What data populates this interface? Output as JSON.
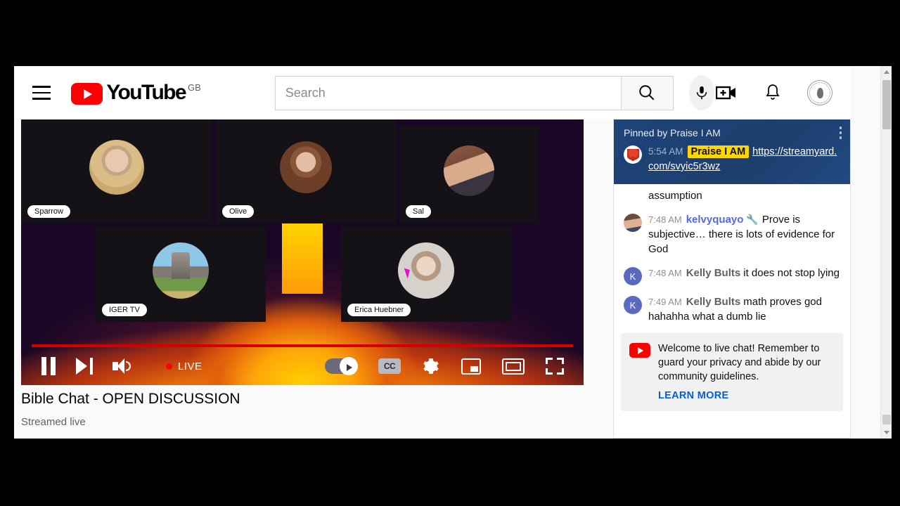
{
  "masthead": {
    "menu_label": "Guide",
    "logo_text": "YouTube",
    "country_code": "GB",
    "search_placeholder": "Search",
    "search_value": "",
    "search_button_label": "Search",
    "mic_label": "Search with your voice",
    "create_label": "Create",
    "notifications_label": "Notifications",
    "avatar_label": "Account"
  },
  "player": {
    "state": "playing",
    "live_label": "LIVE",
    "progress_percent": 100,
    "pause_label": "Pause",
    "next_label": "Next",
    "volume_label": "Mute",
    "autoplay_label": "Autoplay is on",
    "captions_label": "CC",
    "settings_label": "Settings",
    "miniplayer_label": "Miniplayer",
    "theater_label": "Theater mode",
    "fullscreen_label": "Full screen",
    "participants": [
      {
        "name": "Sparrow",
        "avatar": "blonde"
      },
      {
        "name": "Olive",
        "avatar": "brunette"
      },
      {
        "name": "Sal",
        "avatar": "man"
      },
      {
        "name": "IGER TV",
        "avatar": "scene"
      },
      {
        "name": "Erica Huebner",
        "avatar": "girl"
      }
    ]
  },
  "video": {
    "title": "Bible Chat - OPEN DISCUSSION",
    "subtitle": "Streamed live"
  },
  "chat": {
    "pinned": {
      "banner_label": "Pinned by Praise I AM",
      "time": "5:54 AM",
      "author": "Praise I AM",
      "link_text": "https://streamyard.com/svyic5r3wz",
      "menu_label": "More options",
      "background_color": "#1d3e6e",
      "author_highlight_color": "#ffd600"
    },
    "truncated_top_message": "assumption",
    "messages": [
      {
        "time": "7:48 AM",
        "author": "kelvyquayo",
        "badge": "moderator-wrench",
        "author_color": "#5768e0",
        "avatar_type": "photo",
        "avatar_letter": "",
        "text": "Prove is subjective… there is lots of evidence for God"
      },
      {
        "time": "7:48 AM",
        "author": "Kelly Bults",
        "badge": "",
        "author_color": "#606060",
        "avatar_type": "letter",
        "avatar_letter": "K",
        "text": "it does not stop lying"
      },
      {
        "time": "7:49 AM",
        "author": "Kelly Bults",
        "badge": "",
        "author_color": "#606060",
        "avatar_type": "letter",
        "avatar_letter": "K",
        "text": "math proves god hahahha what a dumb lie"
      }
    ],
    "notice": {
      "text": "Welcome to live chat! Remember to guard your privacy and abide by our community guidelines.",
      "link_label": "LEARN MORE",
      "link_color": "#065fd4"
    }
  },
  "browser": {
    "scrollbar_up_label": "Scroll up",
    "scrollbar_down_label": "Scroll down"
  }
}
